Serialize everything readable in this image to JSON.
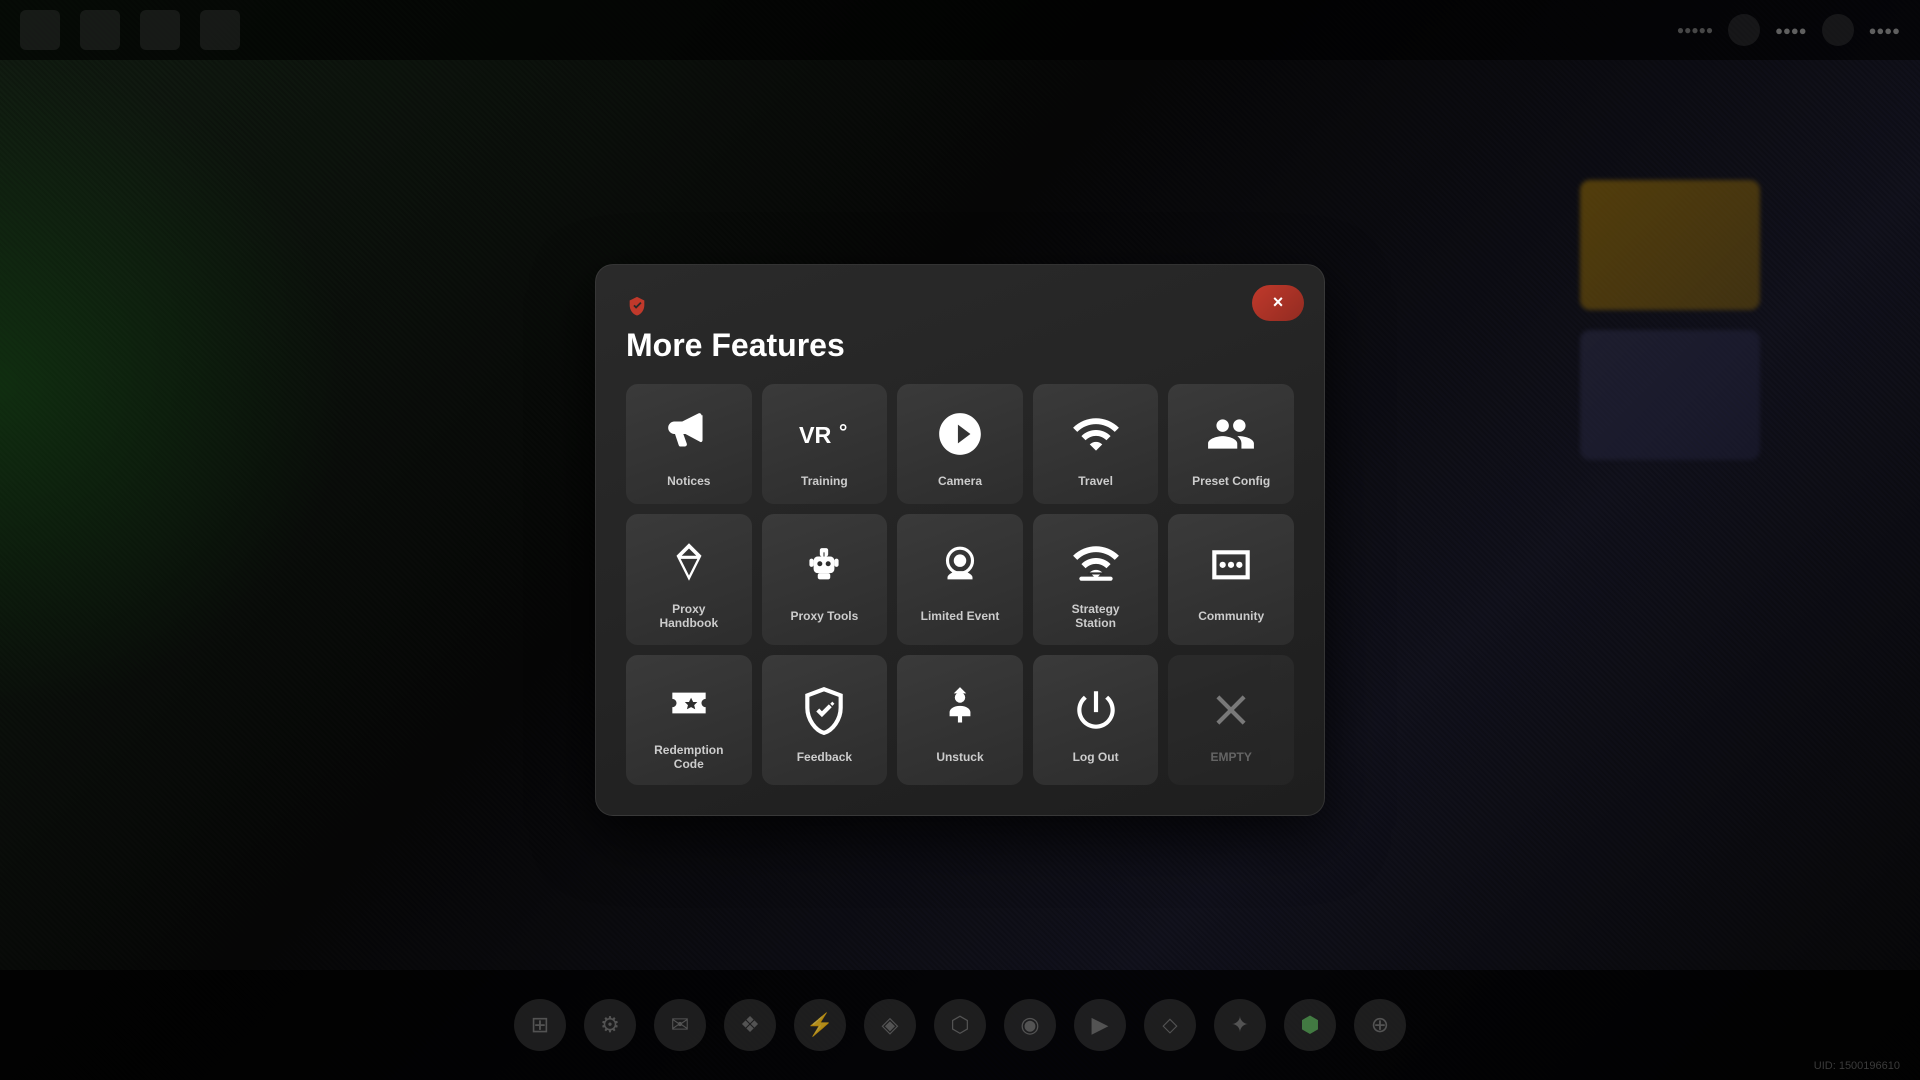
{
  "modal": {
    "title": "More Features",
    "close_label": "×"
  },
  "uid": "UID: 1500196610",
  "grid_items": [
    {
      "id": "notices",
      "label": "Notices",
      "icon": "megaphone"
    },
    {
      "id": "training",
      "label": "Training",
      "icon": "vr"
    },
    {
      "id": "camera",
      "label": "Camera",
      "icon": "camera"
    },
    {
      "id": "travel",
      "label": "Travel",
      "icon": "travel"
    },
    {
      "id": "preset-config",
      "label": "Preset Config",
      "icon": "preset"
    },
    {
      "id": "proxy-handbook",
      "label": "Proxy Handbook",
      "icon": "handbook"
    },
    {
      "id": "proxy-tools",
      "label": "Proxy Tools",
      "icon": "tools"
    },
    {
      "id": "limited-event",
      "label": "Limited Event",
      "icon": "event"
    },
    {
      "id": "strategy-station",
      "label": "Strategy Station",
      "icon": "strategy"
    },
    {
      "id": "community",
      "label": "Community",
      "icon": "community"
    },
    {
      "id": "redemption-code",
      "label": "Redemption Code",
      "icon": "redemption"
    },
    {
      "id": "feedback",
      "label": "Feedback",
      "icon": "feedback"
    },
    {
      "id": "unstuck",
      "label": "Unstuck",
      "icon": "unstuck"
    },
    {
      "id": "log-out",
      "label": "Log Out",
      "icon": "logout"
    },
    {
      "id": "empty",
      "label": "EMPTY",
      "icon": "empty"
    }
  ]
}
